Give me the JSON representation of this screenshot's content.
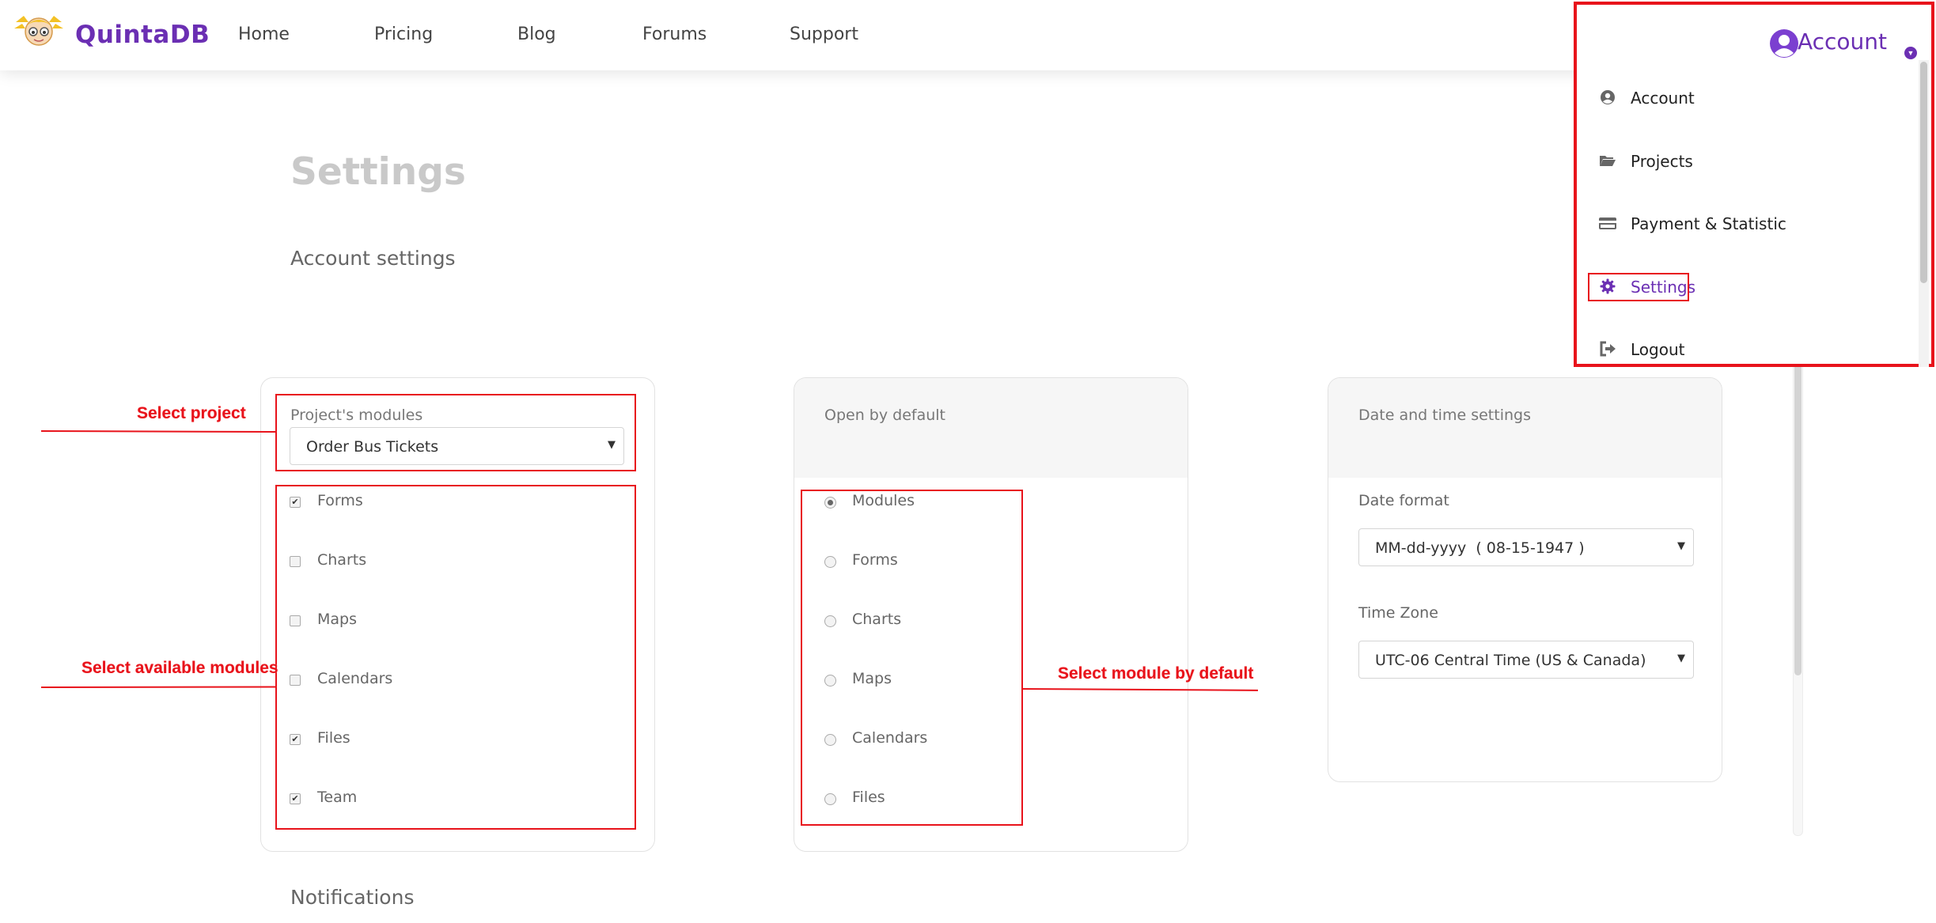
{
  "brand": {
    "name": "QuintaDB",
    "logo_icon": "mascot-logo-icon"
  },
  "nav": {
    "items": [
      {
        "label": "Home"
      },
      {
        "label": "Pricing"
      },
      {
        "label": "Blog"
      },
      {
        "label": "Forums"
      },
      {
        "label": "Support"
      }
    ]
  },
  "page": {
    "title": "Settings",
    "section_title": "Account settings",
    "notifications_title": "Notifications"
  },
  "modules_card": {
    "label": "Project's modules",
    "project_select_value": "Order Bus Tickets",
    "options": [
      {
        "label": "Forms",
        "checked": true
      },
      {
        "label": "Charts",
        "checked": false
      },
      {
        "label": "Maps",
        "checked": false
      },
      {
        "label": "Calendars",
        "checked": false
      },
      {
        "label": "Files",
        "checked": true
      },
      {
        "label": "Team",
        "checked": true
      }
    ]
  },
  "default_card": {
    "label": "Open by default",
    "options": [
      {
        "label": "Modules",
        "selected": true
      },
      {
        "label": "Forms",
        "selected": false
      },
      {
        "label": "Charts",
        "selected": false
      },
      {
        "label": "Maps",
        "selected": false
      },
      {
        "label": "Calendars",
        "selected": false
      },
      {
        "label": "Files",
        "selected": false
      }
    ]
  },
  "datetime_card": {
    "label": "Date and time settings",
    "date_format_label": "Date format",
    "date_format_value": "MM-dd-yyyy  ( 08-15-1947 )",
    "timezone_label": "Time Zone",
    "timezone_value": "UTC-06 Central Time (US & Canada)"
  },
  "annotations": {
    "select_project": "Select project",
    "select_modules": "Select available modules",
    "select_default": "Select module by default"
  },
  "account_menu": {
    "trigger_label": "Account",
    "items": [
      {
        "label": "Account",
        "icon": "user-circle-icon",
        "active": false
      },
      {
        "label": "Projects",
        "icon": "folder-open-icon",
        "active": false
      },
      {
        "label": "Payment & Statistic",
        "icon": "credit-card-icon",
        "active": false
      },
      {
        "label": "Settings",
        "icon": "gear-icon",
        "active": true
      },
      {
        "label": "Logout",
        "icon": "sign-out-icon",
        "active": false
      }
    ]
  },
  "colors": {
    "brand_purple": "#6b2fb3",
    "annotation_red": "#e8131b"
  }
}
